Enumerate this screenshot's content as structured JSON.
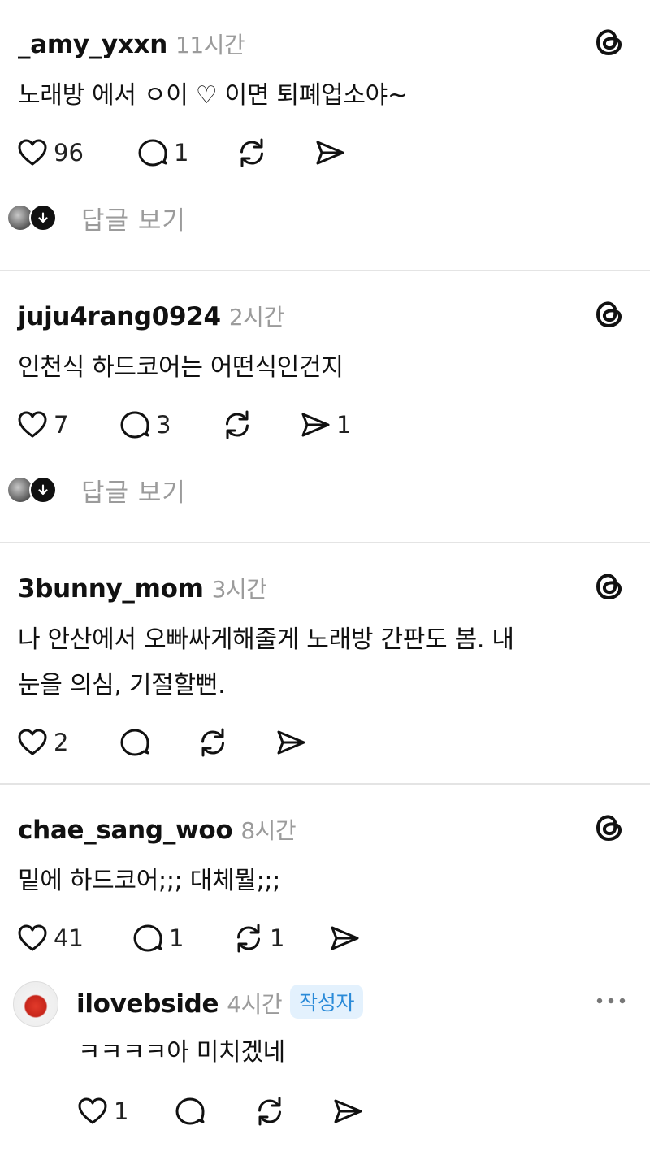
{
  "posts": [
    {
      "username": "_amy_yxxn",
      "time": "11시간",
      "text": "노래방 에서 ㅇ이 ♡ 이면 퇴폐업소야~",
      "likes": "96",
      "comments": "1",
      "reposts": "",
      "shares": "",
      "view_replies": "답글 보기"
    },
    {
      "username": "juju4rang0924",
      "time": "2시간",
      "text": "인천식 하드코어는 어떤식인건지",
      "likes": "7",
      "comments": "3",
      "reposts": "",
      "shares": "1",
      "view_replies": "답글 보기"
    },
    {
      "username": "3bunny_mom",
      "time": "3시간",
      "text_line1": "나 안산에서 오빠싸게해줄게 노래방 간판도 봄. 내",
      "text_line2": "눈을 의심, 기절할뻔.",
      "likes": "2",
      "comments": "",
      "reposts": "",
      "shares": ""
    },
    {
      "username": "chae_sang_woo",
      "time": "8시간",
      "text": "밑에 하드코어;;; 대체뭘;;;",
      "likes": "41",
      "comments": "1",
      "reposts": "1",
      "shares": ""
    }
  ],
  "reply": {
    "username": "ilovebside",
    "time": "4시간",
    "badge": "작성자",
    "text": "ㅋㅋㅋㅋ아 미치겠네",
    "likes": "1",
    "comments": "",
    "reposts": "",
    "shares": ""
  },
  "icons": {
    "brand": "threads-icon",
    "like": "heart-icon",
    "comment": "comment-icon",
    "repost": "repost-icon",
    "share": "share-icon",
    "more": "more-icon"
  }
}
